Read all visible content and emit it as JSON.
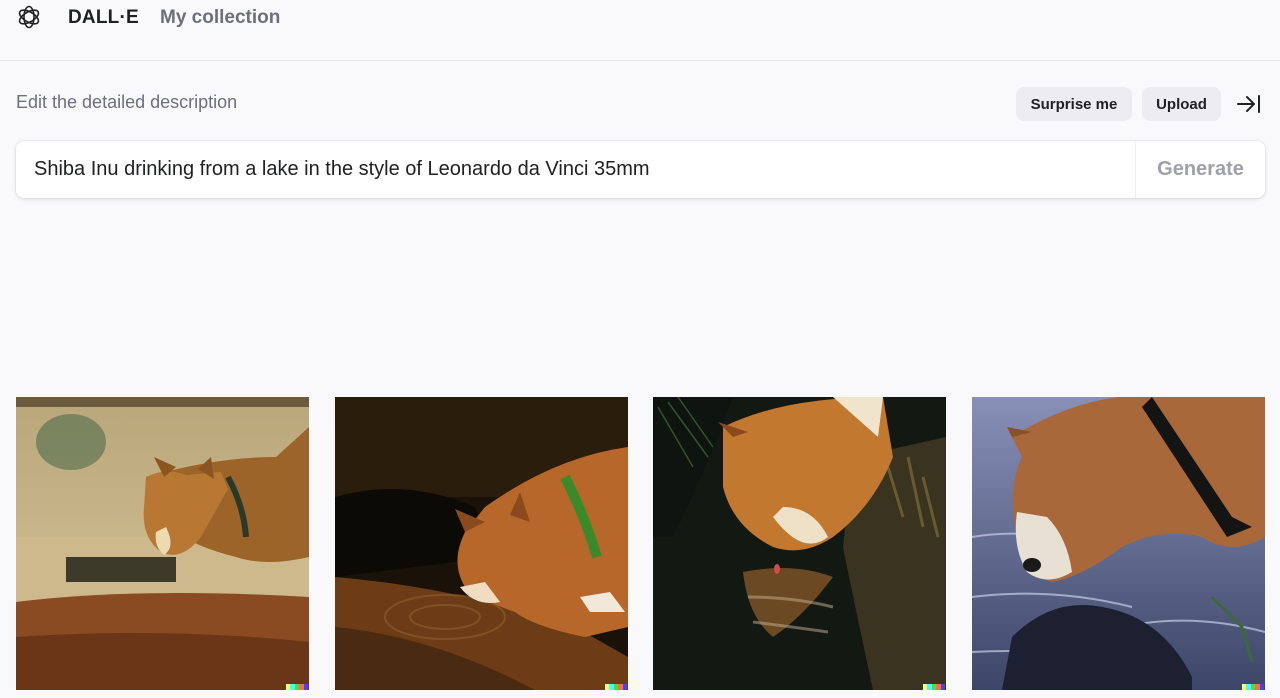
{
  "header": {
    "brand": "DALL·E",
    "nav_collection": "My collection"
  },
  "editor": {
    "description_label": "Edit the detailed description",
    "surprise_label": "Surprise me",
    "upload_label": "Upload",
    "prompt_value": "Shiba Inu drinking from a lake in the style of Leonardo da Vinci 35mm",
    "generate_label": "Generate"
  },
  "results": {
    "images": [
      {
        "subject": "shiba-inu-drinking-at-lakeshore-with-pine-needles"
      },
      {
        "subject": "shiba-inu-drinking-from-dark-water-with-green-collar"
      },
      {
        "subject": "shiba-inu-reflection-in-dark-water-with-grass"
      },
      {
        "subject": "shiba-inu-drinking-from-blue-lake-with-black-collar"
      }
    ],
    "signature_colors": [
      "#ffff66",
      "#42ffff",
      "#51da4c",
      "#ff6e3c",
      "#3c46ff"
    ]
  },
  "theme": {
    "background": "#f9f9fb",
    "pill_background": "#ececf1",
    "text_muted": "#6e6e80",
    "generate_disabled": "#a0a0ab"
  }
}
